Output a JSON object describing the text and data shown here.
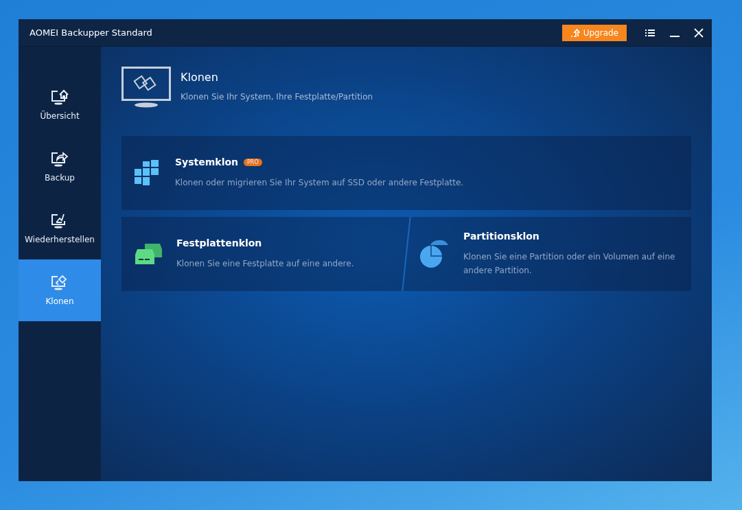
{
  "window": {
    "title": "AOMEI Backupper Standard"
  },
  "upgrade_button": {
    "label": "Upgrade"
  },
  "sidebar": {
    "items": [
      {
        "label": "Übersicht",
        "kind": "home",
        "selected": false
      },
      {
        "label": "Backup",
        "kind": "share",
        "selected": false
      },
      {
        "label": "Wiederherstellen",
        "kind": "restore",
        "selected": false
      },
      {
        "label": "Klonen",
        "kind": "clone",
        "selected": true
      }
    ]
  },
  "header": {
    "title": "Klonen",
    "subtitle": "Klonen Sie Ihr System, Ihre Festplatte/Partition"
  },
  "rows": [
    {
      "options": [
        {
          "kind": "windows",
          "title": "Systemklon",
          "badge": "PRO",
          "description": "Klonen oder migrieren Sie Ihr System auf SSD oder andere Festplatte."
        }
      ]
    },
    {
      "options": [
        {
          "kind": "disk",
          "title": "Festplattenklon",
          "description": "Klonen Sie eine Festplatte auf eine andere."
        },
        {
          "kind": "pie",
          "title": "Partitionsklon",
          "description": "Klonen Sie eine Partition oder ein Volumen auf eine andere Partition."
        }
      ]
    }
  ]
}
